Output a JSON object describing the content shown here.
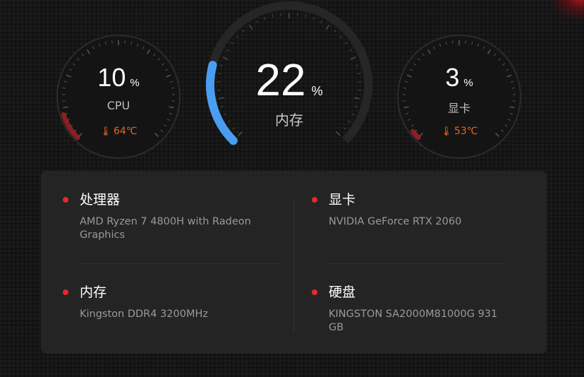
{
  "gauges": {
    "cpu": {
      "value": "10",
      "unit": "%",
      "label": "CPU",
      "temperature": "64℃",
      "percent": 10,
      "color": "#e8282e"
    },
    "memory": {
      "value": "22",
      "unit": "%",
      "label": "内存",
      "percent": 22,
      "color": "#4a9ef0"
    },
    "gpu": {
      "value": "3",
      "unit": "%",
      "label": "显卡",
      "temperature": "53℃",
      "percent": 3,
      "color": "#e8282e"
    }
  },
  "icons": {
    "temperature": "thermometer-icon",
    "bullet": "red-dot-icon"
  },
  "specs": {
    "cpu": {
      "title": "处理器",
      "value": "AMD Ryzen 7 4800H with Radeon Graphics"
    },
    "gpu": {
      "title": "显卡",
      "value": "NVIDIA GeForce RTX 2060"
    },
    "memory": {
      "title": "内存",
      "value": "Kingston DDR4 3200MHz"
    },
    "disk": {
      "title": "硬盘",
      "value": "KINGSTON SA2000M81000G 931 GB"
    }
  },
  "colors": {
    "accent": "#e8282e",
    "temperature": "#e8671c",
    "memory_arc": "#4a9ef0"
  }
}
